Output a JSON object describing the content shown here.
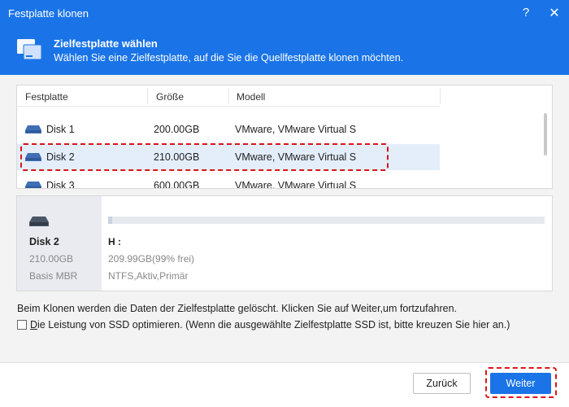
{
  "window": {
    "title": "Festplatte klonen",
    "help_glyph": "?",
    "close_glyph": "✕"
  },
  "header": {
    "icon": "disk-stack-icon",
    "title": "Zielfestplatte wählen",
    "subtitle": "Wählen Sie eine Zielfestplatte, auf die Sie die Quellfestplatte klonen möchten."
  },
  "table": {
    "columns": [
      "Festplatte",
      "Größe",
      "Modell"
    ],
    "rows": [
      {
        "name": "Disk 1",
        "size": "200.00GB",
        "model": "VMware, VMware Virtual S",
        "selected": false
      },
      {
        "name": "Disk 2",
        "size": "210.00GB",
        "model": "VMware, VMware Virtual S",
        "selected": true
      },
      {
        "name": "Disk 3",
        "size": "600.00GB",
        "model": "VMware, VMware Virtual S",
        "selected": false
      }
    ]
  },
  "detail": {
    "disk_name": "Disk 2",
    "disk_size": "210.00GB",
    "disk_type": "Basis MBR",
    "partition_label": "H :",
    "partition_free": "209.99GB(99% frei)",
    "partition_fs": "NTFS,Aktiv,Primär",
    "used_fraction": 0.01
  },
  "notice": "Beim Klonen werden die Daten der Zielfestplatte gelöscht. Klicken Sie auf Weiter,um fortzufahren.",
  "ssd_option": {
    "mnemonic": "D",
    "label_rest": "ie Leistung von SSD optimieren. (Wenn die ausgewählte Zielfestplatte SSD ist, bitte kreuzen Sie hier an.)",
    "checked": false
  },
  "buttons": {
    "back": "Zurück",
    "next": "Weiter"
  },
  "colors": {
    "accent": "#1a74e8",
    "highlight": "#d9151b",
    "selected_row": "#e4eefb"
  }
}
